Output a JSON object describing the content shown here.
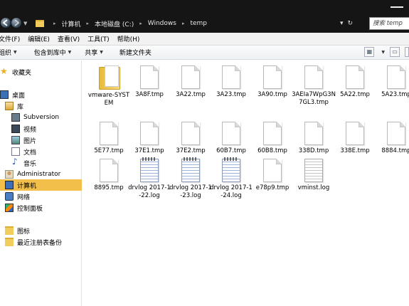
{
  "window": {
    "address": {
      "crumbs": [
        "计算机",
        "本地磁盘 (C:)",
        "Windows",
        "temp"
      ],
      "dropdown_glyph": "▾",
      "refresh_glyph": "↻"
    },
    "search": {
      "placeholder": "搜索 temp"
    }
  },
  "menu": [
    "文件(F)",
    "编辑(E)",
    "查看(V)",
    "工具(T)",
    "帮助(H)"
  ],
  "toolbar": {
    "organize": "组织",
    "include": "包含到库中",
    "share": "共享",
    "new_folder": "新建文件夹"
  },
  "sidebar": {
    "favorites": "收藏夹",
    "desktop": "桌面",
    "library": "库",
    "subversion": "Subversion",
    "videos": "视频",
    "pictures": "图片",
    "documents": "文档",
    "music": "音乐",
    "administrator": "Administrator",
    "computer": "计算机",
    "network": "网络",
    "control_panel": "控制面板",
    "icons": "图标",
    "registry_backup": "最近注册表备份"
  },
  "files": [
    {
      "name": "vmware-SYSTEM",
      "kind": "folder"
    },
    {
      "name": "3A8F.tmp",
      "kind": "page"
    },
    {
      "name": "3A22.tmp",
      "kind": "page"
    },
    {
      "name": "3A23.tmp",
      "kind": "page"
    },
    {
      "name": "3A90.tmp",
      "kind": "page"
    },
    {
      "name": "3AEIa7WpG3N7GL3.tmp",
      "kind": "page"
    },
    {
      "name": "5A22.tmp",
      "kind": "page"
    },
    {
      "name": "5A23.tmp",
      "kind": "page"
    },
    {
      "name": "5E77.tmp",
      "kind": "page"
    },
    {
      "name": "37E1.tmp",
      "kind": "page"
    },
    {
      "name": "37E2.tmp",
      "kind": "page"
    },
    {
      "name": "60B7.tmp",
      "kind": "page"
    },
    {
      "name": "60B8.tmp",
      "kind": "page"
    },
    {
      "name": "338D.tmp",
      "kind": "page"
    },
    {
      "name": "338E.tmp",
      "kind": "page"
    },
    {
      "name": "8884.tmp",
      "kind": "page"
    },
    {
      "name": "8895.tmp",
      "kind": "page"
    },
    {
      "name": "drvlog 2017-1-22.log",
      "kind": "log"
    },
    {
      "name": "drvlog 2017-1-23.log",
      "kind": "log"
    },
    {
      "name": "drvlog 2017-1-24.log",
      "kind": "log"
    },
    {
      "name": "e78p9.tmp",
      "kind": "page"
    },
    {
      "name": "vminst.log",
      "kind": "log-text"
    }
  ]
}
